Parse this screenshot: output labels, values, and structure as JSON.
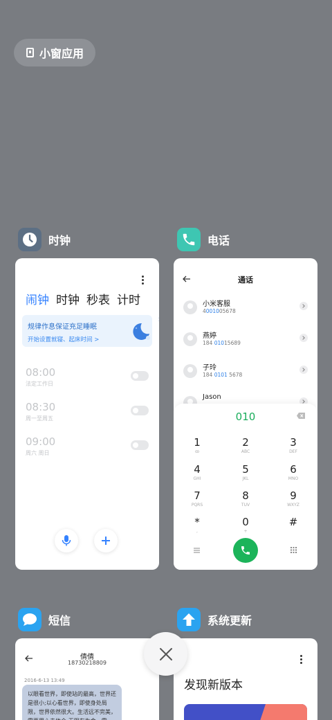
{
  "small_window": {
    "label": "小窗应用"
  },
  "clock": {
    "app_name": "时钟",
    "tabs": [
      "闹钟",
      "时钟",
      "秒表",
      "计时"
    ],
    "banner": {
      "title": "规律作息保证充足睡眠",
      "subtitle": "开始设置就寝、起床时间 >",
      "close": "×"
    },
    "alarms": [
      {
        "time": "08:00",
        "repeat": "法定工作日"
      },
      {
        "time": "08:30",
        "repeat": "周一至周五"
      },
      {
        "time": "09:00",
        "repeat": "周六 周日"
      }
    ],
    "colors": {
      "accent": "#3482ff",
      "icon_bg": "#5c6f84"
    }
  },
  "phone": {
    "app_name": "电话",
    "title": "通话",
    "contacts": [
      {
        "name": "小米客服",
        "num_pre": "4",
        "num_hl": "0010",
        "num_post": "05678"
      },
      {
        "name": "燕婷",
        "num_pre": "184 ",
        "num_hl": "010",
        "num_post": "15689"
      },
      {
        "name": "子玲",
        "num_pre": "184 ",
        "num_hl": "0101",
        "num_post": " 5678"
      },
      {
        "name": "Jason",
        "num_pre": "",
        "num_hl": "",
        "num_post": ""
      }
    ],
    "dial_input": "010",
    "keys": [
      {
        "d": "1",
        "l": "ꝏ"
      },
      {
        "d": "2",
        "l": "ABC"
      },
      {
        "d": "3",
        "l": "DEF"
      },
      {
        "d": "4",
        "l": "GHI"
      },
      {
        "d": "5",
        "l": "JKL"
      },
      {
        "d": "6",
        "l": "MNO"
      },
      {
        "d": "7",
        "l": "PQRS"
      },
      {
        "d": "8",
        "l": "TUV"
      },
      {
        "d": "9",
        "l": "WXYZ"
      },
      {
        "d": "*",
        "l": ","
      },
      {
        "d": "0",
        "l": "+"
      },
      {
        "d": "#",
        "l": ""
      }
    ],
    "colors": {
      "call": "#1cb45a",
      "highlight": "#2d80e8",
      "icon_bg": "#3ec6b2"
    }
  },
  "sms": {
    "app_name": "短信",
    "contact_name": "倩倩",
    "contact_number": "18730218809",
    "date": "2016-6-13 13:49",
    "message": "以眼看世界，即使站的最高，世界还是很小;以心看世界，即使身处局限，世界依然很大。生活远不完美，需要用心去体会;无限有生命，需",
    "colors": {
      "icon_bg": "#2aa3f0",
      "bubble": "#c2cde0"
    }
  },
  "update": {
    "app_name": "系统更新",
    "title": "发现新版本",
    "colors": {
      "icon_bg": "#2aa3f0",
      "banner_blue": "#4250c7",
      "banner_coral": "#f47a6e"
    }
  }
}
